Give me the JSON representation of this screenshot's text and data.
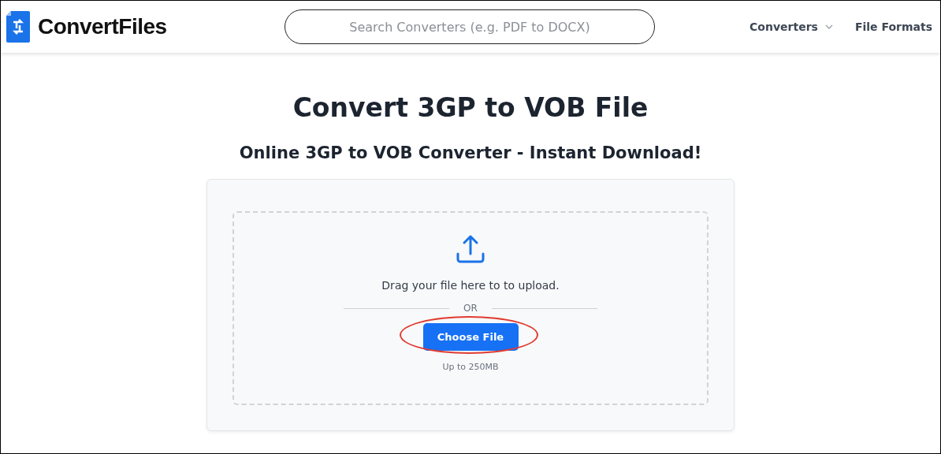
{
  "header": {
    "logo_text": "ConvertFiles",
    "search": {
      "placeholder": "Search Converters (e.g. PDF to DOCX)"
    },
    "nav": [
      {
        "label": "Converters",
        "dropdown": true
      },
      {
        "label": "File Formats",
        "dropdown": false
      }
    ]
  },
  "title": "Convert 3GP to VOB File",
  "subtitle": "Online 3GP to VOB Converter - Instant Download!",
  "upload": {
    "prompt": "Drag your file here to to upload.",
    "divider_text": "OR",
    "button": {
      "label": "Choose File",
      "circled": true
    },
    "limit": "Up to 250MB"
  }
}
